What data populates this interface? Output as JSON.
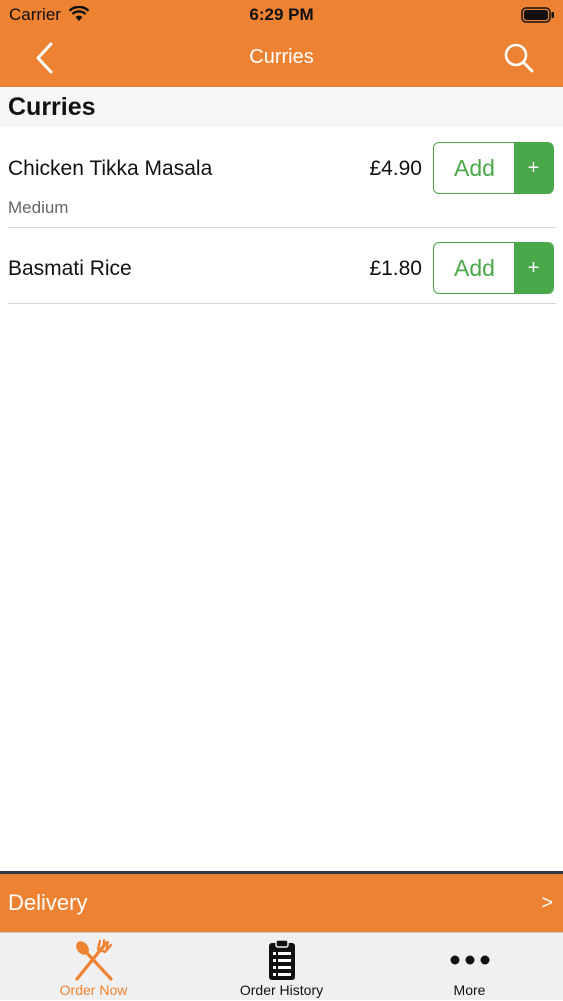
{
  "status": {
    "carrier": "Carrier",
    "time": "6:29 PM"
  },
  "nav": {
    "title": "Curries",
    "back_icon": "chevron-left-icon",
    "search_icon": "search-icon"
  },
  "section": {
    "title": "Curries"
  },
  "items": [
    {
      "name": "Chicken Tikka Masala",
      "subtitle": "Medium",
      "price": "£4.90",
      "add_label": "Add",
      "plus_label": "+"
    },
    {
      "name": "Basmati Rice",
      "price": "£1.80",
      "add_label": "Add",
      "plus_label": "+"
    }
  ],
  "delivery": {
    "label": "Delivery",
    "arrow": ">"
  },
  "tabs": [
    {
      "label": "Order Now",
      "icon": "fork-spoon-icon",
      "active": true
    },
    {
      "label": "Order History",
      "icon": "clipboard-list-icon",
      "active": false
    },
    {
      "label": "More",
      "icon": "more-dots-icon",
      "active": false
    }
  ],
  "colors": {
    "accent": "#ee8233",
    "green": "#4aa84a",
    "tab_active": "#ee8233",
    "tab_inactive": "#111111"
  }
}
